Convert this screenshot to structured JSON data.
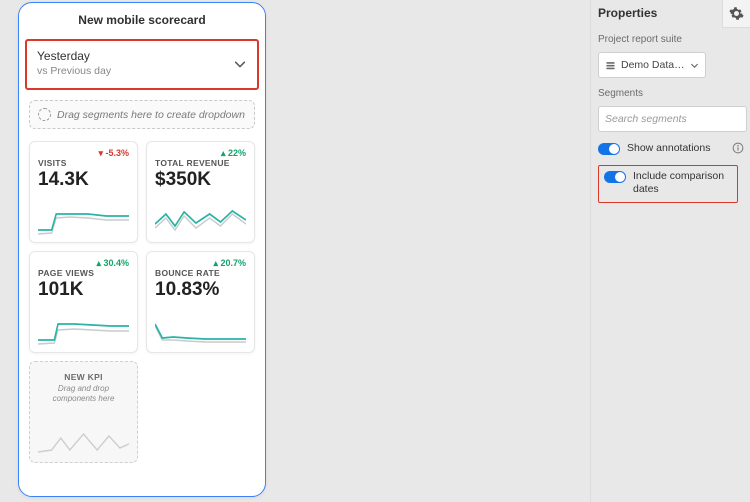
{
  "scorecard": {
    "title": "New mobile scorecard",
    "date": {
      "primary": "Yesterday",
      "secondary": "vs Previous day"
    },
    "segment_hint": "Drag segments here to create dropdown",
    "tiles": [
      {
        "label": "VISITS",
        "value": "14.3K",
        "delta": "-5.3%",
        "dir": "down"
      },
      {
        "label": "TOTAL REVENUE",
        "value": "$350K",
        "delta": "22%",
        "dir": "up"
      },
      {
        "label": "PAGE VIEWS",
        "value": "101K",
        "delta": "30.4%",
        "dir": "up"
      },
      {
        "label": "BOUNCE RATE",
        "value": "10.83%",
        "delta": "20.7%",
        "dir": "up"
      }
    ],
    "placeholder": {
      "label": "NEW KPI",
      "sub": "Drag and drop components here"
    }
  },
  "properties": {
    "title": "Properties",
    "suite_label": "Project report suite",
    "suite_value": "Demo Data Adob…",
    "segments_label": "Segments",
    "segments_placeholder": "Search segments",
    "toggles": {
      "annotations": "Show annotations",
      "compare": "Include comparison dates"
    }
  },
  "colors": {
    "accent": "#1473e6",
    "danger": "#d9382b",
    "success": "#11a36a",
    "teal": "#2ab3a6"
  }
}
